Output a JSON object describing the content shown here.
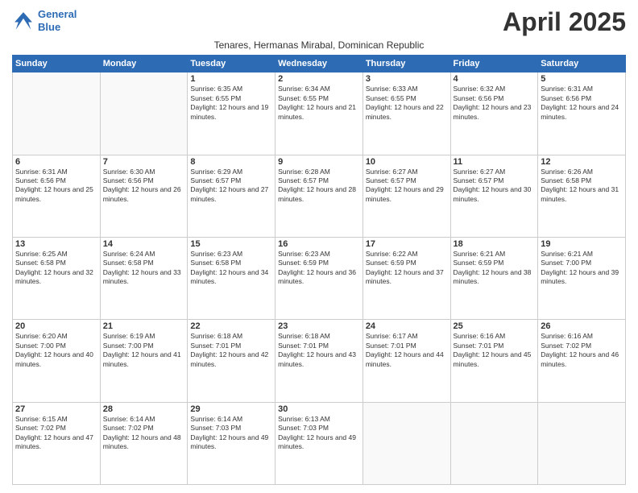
{
  "header": {
    "logo_line1": "General",
    "logo_line2": "Blue",
    "month_title": "April 2025",
    "subtitle": "Tenares, Hermanas Mirabal, Dominican Republic"
  },
  "days_of_week": [
    "Sunday",
    "Monday",
    "Tuesday",
    "Wednesday",
    "Thursday",
    "Friday",
    "Saturday"
  ],
  "weeks": [
    [
      {
        "day": "",
        "info": ""
      },
      {
        "day": "",
        "info": ""
      },
      {
        "day": "1",
        "info": "Sunrise: 6:35 AM\nSunset: 6:55 PM\nDaylight: 12 hours and 19 minutes."
      },
      {
        "day": "2",
        "info": "Sunrise: 6:34 AM\nSunset: 6:55 PM\nDaylight: 12 hours and 21 minutes."
      },
      {
        "day": "3",
        "info": "Sunrise: 6:33 AM\nSunset: 6:55 PM\nDaylight: 12 hours and 22 minutes."
      },
      {
        "day": "4",
        "info": "Sunrise: 6:32 AM\nSunset: 6:56 PM\nDaylight: 12 hours and 23 minutes."
      },
      {
        "day": "5",
        "info": "Sunrise: 6:31 AM\nSunset: 6:56 PM\nDaylight: 12 hours and 24 minutes."
      }
    ],
    [
      {
        "day": "6",
        "info": "Sunrise: 6:31 AM\nSunset: 6:56 PM\nDaylight: 12 hours and 25 minutes."
      },
      {
        "day": "7",
        "info": "Sunrise: 6:30 AM\nSunset: 6:56 PM\nDaylight: 12 hours and 26 minutes."
      },
      {
        "day": "8",
        "info": "Sunrise: 6:29 AM\nSunset: 6:57 PM\nDaylight: 12 hours and 27 minutes."
      },
      {
        "day": "9",
        "info": "Sunrise: 6:28 AM\nSunset: 6:57 PM\nDaylight: 12 hours and 28 minutes."
      },
      {
        "day": "10",
        "info": "Sunrise: 6:27 AM\nSunset: 6:57 PM\nDaylight: 12 hours and 29 minutes."
      },
      {
        "day": "11",
        "info": "Sunrise: 6:27 AM\nSunset: 6:57 PM\nDaylight: 12 hours and 30 minutes."
      },
      {
        "day": "12",
        "info": "Sunrise: 6:26 AM\nSunset: 6:58 PM\nDaylight: 12 hours and 31 minutes."
      }
    ],
    [
      {
        "day": "13",
        "info": "Sunrise: 6:25 AM\nSunset: 6:58 PM\nDaylight: 12 hours and 32 minutes."
      },
      {
        "day": "14",
        "info": "Sunrise: 6:24 AM\nSunset: 6:58 PM\nDaylight: 12 hours and 33 minutes."
      },
      {
        "day": "15",
        "info": "Sunrise: 6:23 AM\nSunset: 6:58 PM\nDaylight: 12 hours and 34 minutes."
      },
      {
        "day": "16",
        "info": "Sunrise: 6:23 AM\nSunset: 6:59 PM\nDaylight: 12 hours and 36 minutes."
      },
      {
        "day": "17",
        "info": "Sunrise: 6:22 AM\nSunset: 6:59 PM\nDaylight: 12 hours and 37 minutes."
      },
      {
        "day": "18",
        "info": "Sunrise: 6:21 AM\nSunset: 6:59 PM\nDaylight: 12 hours and 38 minutes."
      },
      {
        "day": "19",
        "info": "Sunrise: 6:21 AM\nSunset: 7:00 PM\nDaylight: 12 hours and 39 minutes."
      }
    ],
    [
      {
        "day": "20",
        "info": "Sunrise: 6:20 AM\nSunset: 7:00 PM\nDaylight: 12 hours and 40 minutes."
      },
      {
        "day": "21",
        "info": "Sunrise: 6:19 AM\nSunset: 7:00 PM\nDaylight: 12 hours and 41 minutes."
      },
      {
        "day": "22",
        "info": "Sunrise: 6:18 AM\nSunset: 7:01 PM\nDaylight: 12 hours and 42 minutes."
      },
      {
        "day": "23",
        "info": "Sunrise: 6:18 AM\nSunset: 7:01 PM\nDaylight: 12 hours and 43 minutes."
      },
      {
        "day": "24",
        "info": "Sunrise: 6:17 AM\nSunset: 7:01 PM\nDaylight: 12 hours and 44 minutes."
      },
      {
        "day": "25",
        "info": "Sunrise: 6:16 AM\nSunset: 7:01 PM\nDaylight: 12 hours and 45 minutes."
      },
      {
        "day": "26",
        "info": "Sunrise: 6:16 AM\nSunset: 7:02 PM\nDaylight: 12 hours and 46 minutes."
      }
    ],
    [
      {
        "day": "27",
        "info": "Sunrise: 6:15 AM\nSunset: 7:02 PM\nDaylight: 12 hours and 47 minutes."
      },
      {
        "day": "28",
        "info": "Sunrise: 6:14 AM\nSunset: 7:02 PM\nDaylight: 12 hours and 48 minutes."
      },
      {
        "day": "29",
        "info": "Sunrise: 6:14 AM\nSunset: 7:03 PM\nDaylight: 12 hours and 49 minutes."
      },
      {
        "day": "30",
        "info": "Sunrise: 6:13 AM\nSunset: 7:03 PM\nDaylight: 12 hours and 49 minutes."
      },
      {
        "day": "",
        "info": ""
      },
      {
        "day": "",
        "info": ""
      },
      {
        "day": "",
        "info": ""
      }
    ]
  ]
}
